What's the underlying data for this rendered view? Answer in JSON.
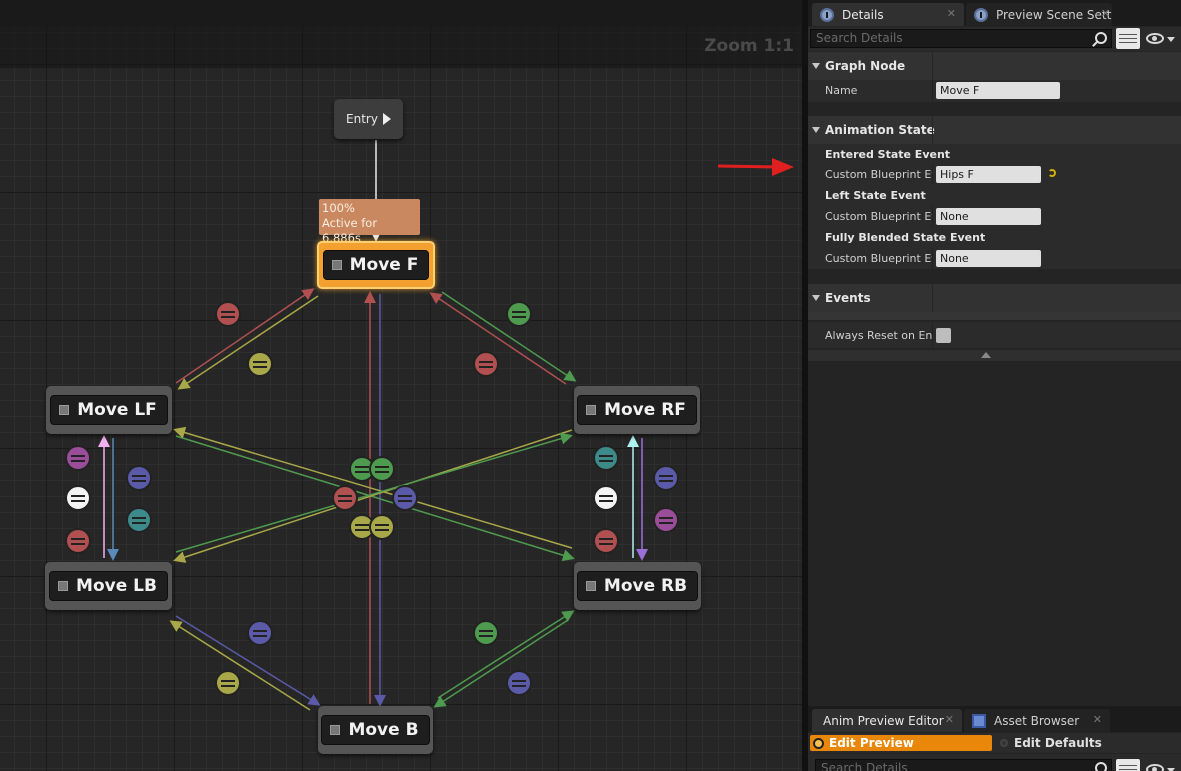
{
  "graph": {
    "zoom_label": "Zoom 1:1",
    "entry": {
      "label": "Entry"
    },
    "tooltip": {
      "line1": "100%",
      "line2": "Active for 6.886s"
    },
    "states": [
      {
        "id": "move-f",
        "label": "Move F",
        "active": true
      },
      {
        "id": "move-lf",
        "label": "Move LF",
        "active": false
      },
      {
        "id": "move-rf",
        "label": "Move RF",
        "active": false
      },
      {
        "id": "move-lb",
        "label": "Move LB",
        "active": false
      },
      {
        "id": "move-rb",
        "label": "Move RB",
        "active": false
      },
      {
        "id": "move-b",
        "label": "Move B",
        "active": false
      }
    ]
  },
  "details_panel": {
    "tabs": [
      {
        "label": "Details",
        "icon": "info-icon",
        "active": true
      },
      {
        "label": "Preview Scene Sett",
        "icon": "info-icon",
        "active": false
      }
    ],
    "search_placeholder": "Search Details",
    "sections": {
      "graph_node": {
        "title": "Graph Node",
        "name_label": "Name",
        "name_value": "Move F"
      },
      "animation_state": {
        "title": "Animation State",
        "entered_label": "Entered State Event",
        "entered_custom_label": "Custom Blueprint Eve",
        "entered_value": "Hips F",
        "left_label": "Left State Event",
        "left_custom_label": "Custom Blueprint Eve",
        "left_value": "None",
        "blended_label": "Fully Blended State Event",
        "blended_custom_label": "Custom Blueprint Eve",
        "blended_value": "None"
      },
      "events": {
        "title": "Events",
        "always_reset_label": "Always Reset on Entr",
        "always_reset_checked": false
      }
    }
  },
  "bottom_panel": {
    "tabs": [
      {
        "label": "Anim Preview Editor",
        "active": true
      },
      {
        "label": "Asset Browser",
        "active": false
      }
    ],
    "edit_preview_label": "Edit Preview",
    "edit_defaults_label": "Edit Defaults",
    "search_placeholder": "Search Details"
  },
  "colors": {
    "active_state": "#f4a030",
    "annotation_arrow": "#e02020",
    "mode_active": "#e8870a"
  }
}
